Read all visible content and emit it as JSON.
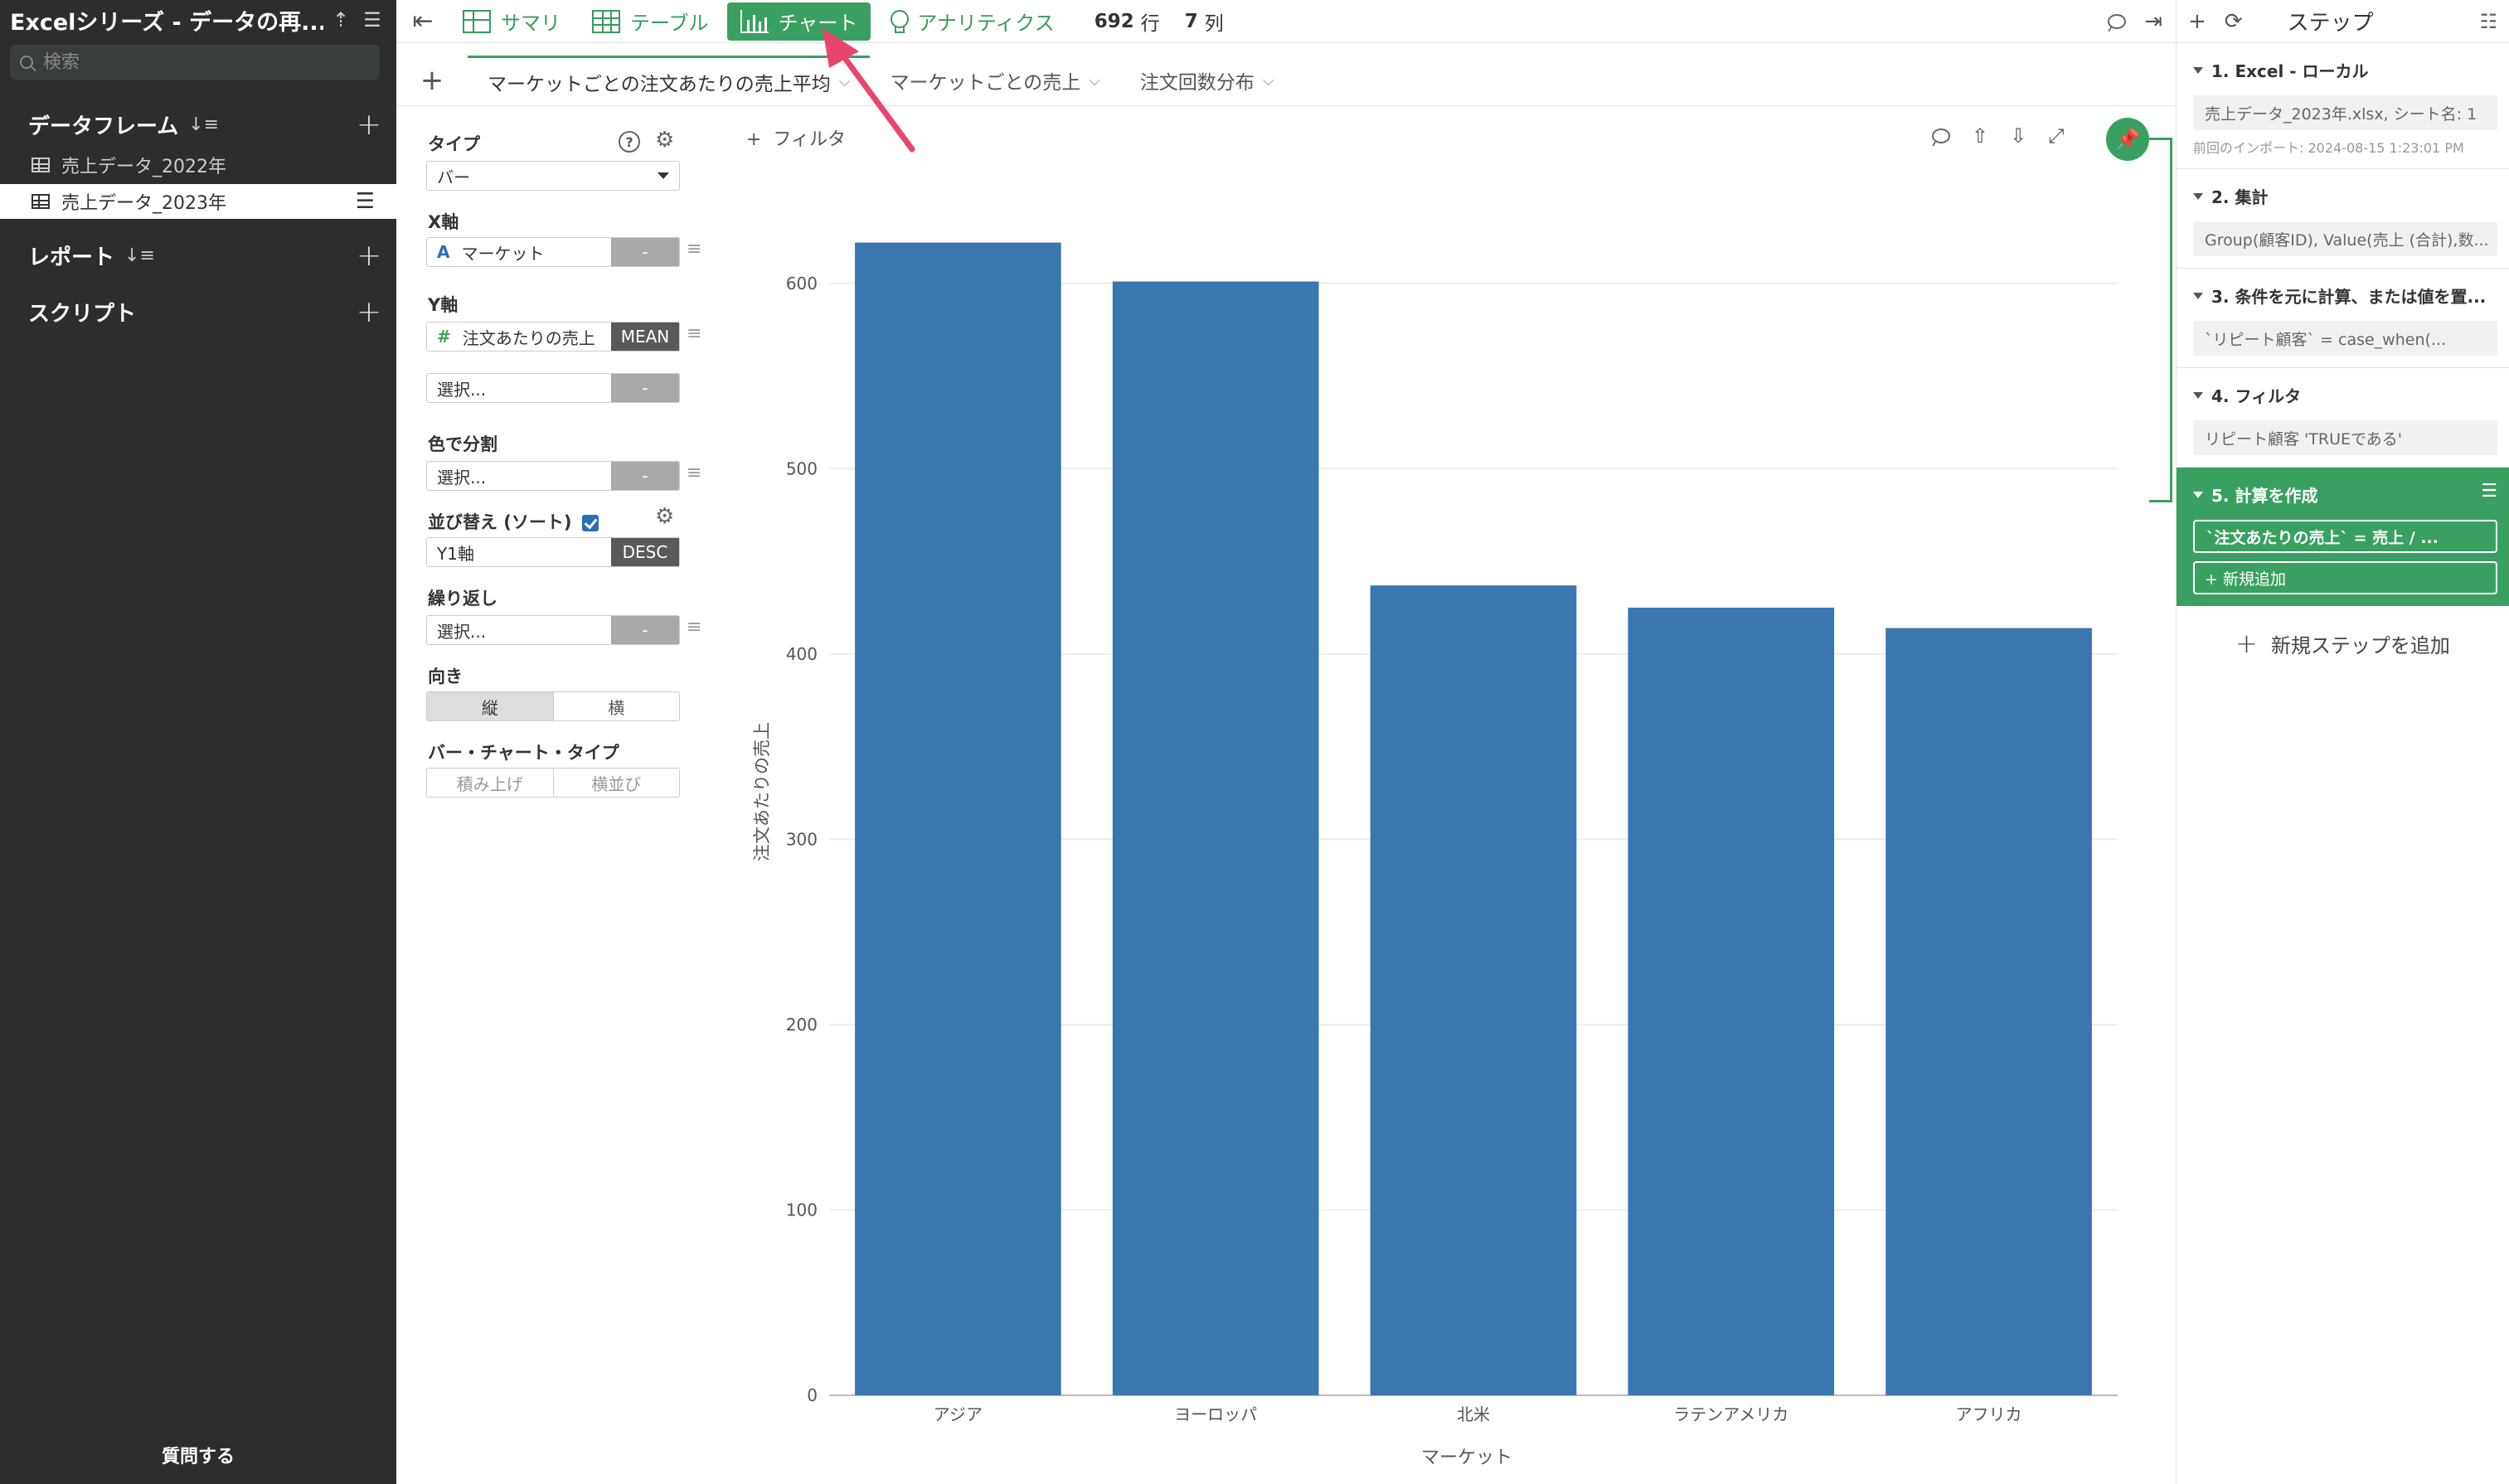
{
  "sidebar": {
    "project_title": "Excelシリーズ - データの再...",
    "search_placeholder": "検索",
    "dataframes_label": "データフレーム",
    "dataframes": [
      {
        "name": "売上データ_2022年"
      },
      {
        "name": "売上データ_2023年"
      }
    ],
    "reports_label": "レポート",
    "scripts_label": "スクリプト",
    "ask_label": "質問する"
  },
  "toolbar": {
    "modes": [
      "サマリ",
      "テーブル",
      "チャート",
      "アナリティクス"
    ],
    "active_mode": "チャート",
    "rows_count": "692",
    "rows_unit": "行",
    "cols_count": "7",
    "cols_unit": "列"
  },
  "tabs": [
    {
      "label": "マーケットごとの注文あたりの売上平均"
    },
    {
      "label": "マーケットごとの売上"
    },
    {
      "label": "注文回数分布"
    }
  ],
  "config": {
    "type_label": "タイプ",
    "type_value": "バー",
    "x_label": "X軸",
    "x_value": "マーケット",
    "x_agg": "-",
    "y_label": "Y軸",
    "y_value": "注文あたりの売上",
    "y_agg": "MEAN",
    "y2_placeholder": "選択...",
    "y2_agg": "-",
    "color_label": "色で分割",
    "color_placeholder": "選択...",
    "color_agg": "-",
    "sort_label": "並び替え (ソート)",
    "sort_value": "Y1軸",
    "sort_order": "DESC",
    "repeat_label": "繰り返し",
    "repeat_placeholder": "選択...",
    "repeat_agg": "-",
    "orientation_label": "向き",
    "orientation_options": [
      "縦",
      "横"
    ],
    "orientation_selected": "縦",
    "bar_type_label": "バー・チャート・タイプ",
    "bar_type_options": [
      "積み上げ",
      "横並び"
    ],
    "help_glyph": "?"
  },
  "chart_toolbar": {
    "filter_label": "フィルタ"
  },
  "chart_data": {
    "type": "bar",
    "categories": [
      "アジア",
      "ヨーロッパ",
      "北米",
      "ラテンアメリカ",
      "アフリカ"
    ],
    "values": [
      622,
      601,
      437,
      425,
      414
    ],
    "xlabel": "マーケット",
    "ylabel": "注文あたりの売上",
    "ylim": [
      0,
      650
    ],
    "yticks": [
      0,
      100,
      200,
      300,
      400,
      500,
      600
    ],
    "bar_color": "#3a76b0",
    "grid": true
  },
  "steps": {
    "title": "ステップ",
    "items": [
      {
        "title": "1. Excel - ローカル",
        "body": "売上データ_2023年.xlsx, シート名: 1",
        "note": "前回のインポート: 2024-08-15 1:23:01 PM"
      },
      {
        "title": "2. 集計",
        "body": "Group(顧客ID), Value(売上 (合計),数..."
      },
      {
        "title": "3. 条件を元に計算、または値を置...",
        "body": "`リピート顧客` = case_when(..."
      },
      {
        "title": "4. フィルタ",
        "body": "リピート顧客 'TRUEである'"
      },
      {
        "title": "5. 計算を作成",
        "body": "`注文あたりの売上` = 売上 / ...",
        "add": "+ 新規追加"
      }
    ],
    "add_step_label": "新規ステップを追加"
  },
  "colors": {
    "accent_green": "#3aa062",
    "sidebar_bg": "#2b2d2e",
    "bar": "#3a76b0",
    "arrow": "#e8456e"
  }
}
